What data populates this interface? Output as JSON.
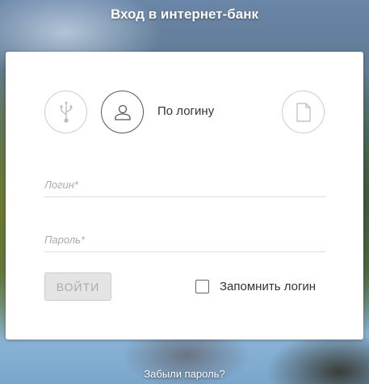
{
  "header": {
    "title": "Вход в интернет-банк"
  },
  "auth_methods": [
    {
      "icon": "usb-icon",
      "active": false
    },
    {
      "icon": "user-icon",
      "active": true,
      "label": "По логину"
    },
    {
      "icon": "document-icon",
      "active": false
    }
  ],
  "form": {
    "login_placeholder": "Логин*",
    "login_value": "",
    "password_placeholder": "Пароль*",
    "password_value": "",
    "submit_label": "ВОЙТИ",
    "remember_label": "Запомнить логин",
    "remember_checked": false
  },
  "footer": {
    "forgot_link": "Забыли пароль?"
  }
}
